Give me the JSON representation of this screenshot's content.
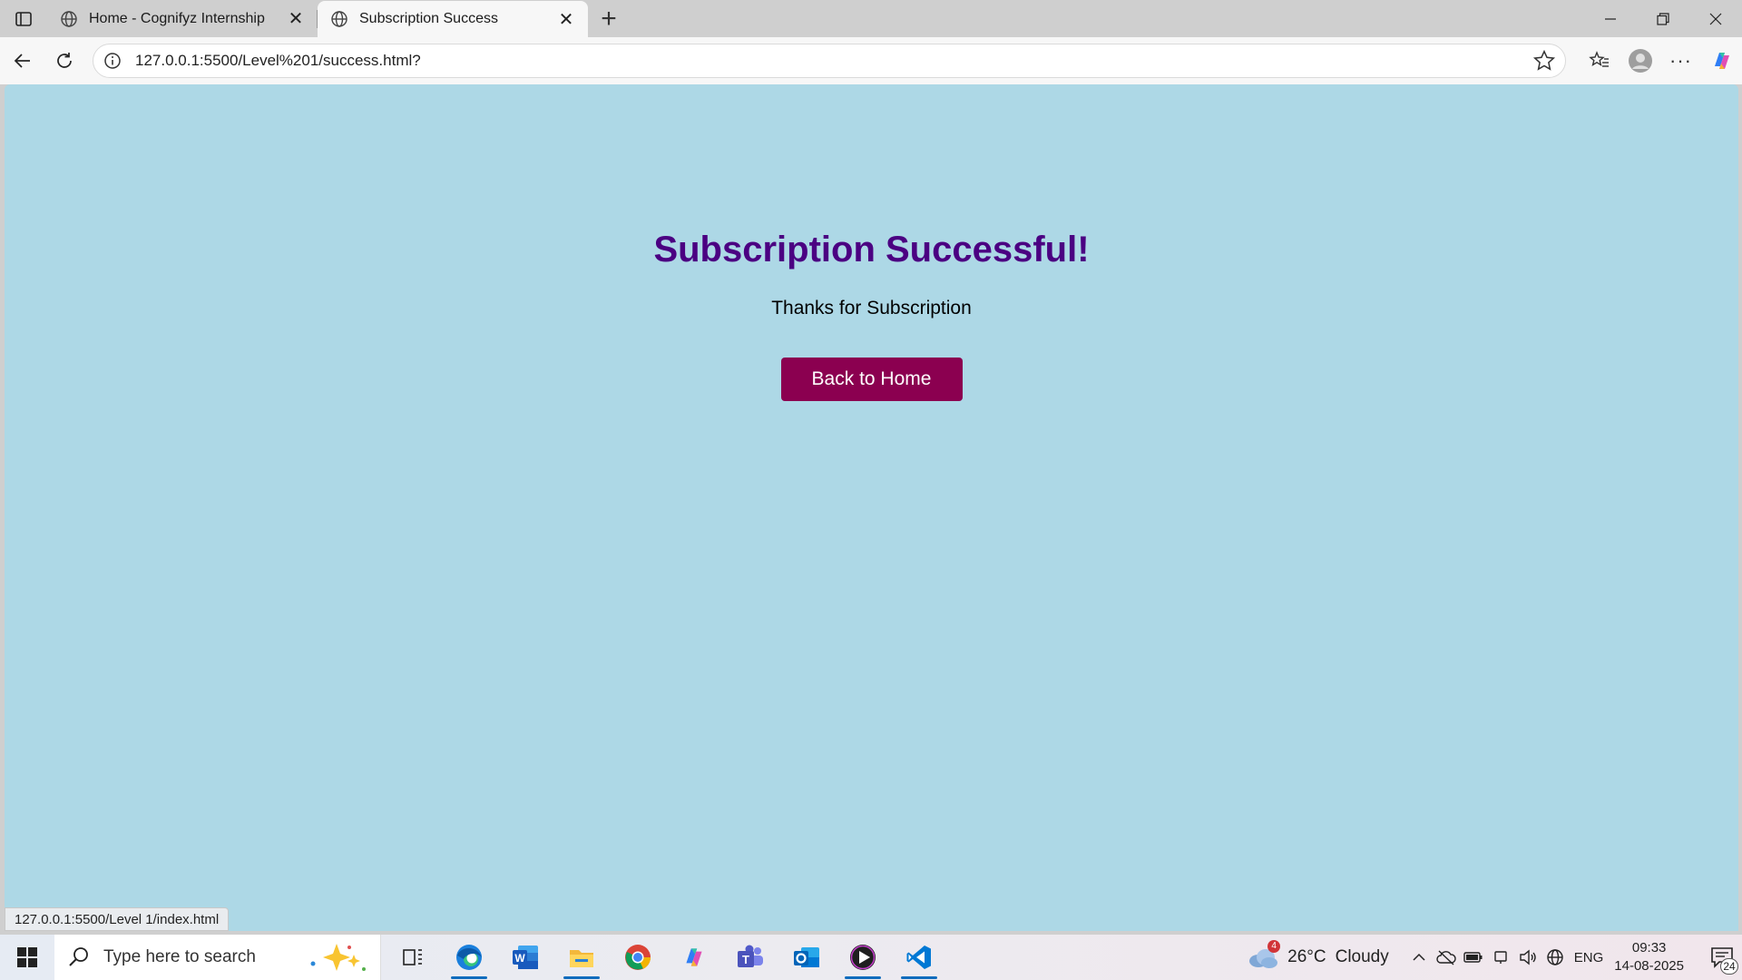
{
  "browser": {
    "tabs": [
      {
        "title": "Home - Cognifyz Internship",
        "active": false
      },
      {
        "title": "Subscription Success",
        "active": true
      }
    ],
    "new_tab_icon": "plus-icon",
    "address": "127.0.0.1:5500/Level%201/success.html?",
    "status_url": "127.0.0.1:5500/Level 1/index.html"
  },
  "page": {
    "background": "#add8e6",
    "heading": "Subscription Successful!",
    "heading_color": "#4b0082",
    "message": "Thanks for Subscription",
    "button_label": "Back to Home",
    "button_color": "#8b0050"
  },
  "taskbar": {
    "search_placeholder": "Type here to search",
    "weather": {
      "temperature": "26°C",
      "condition": "Cloudy",
      "alert_count": "4"
    },
    "language": "ENG",
    "time": "09:33",
    "date": "14-08-2025",
    "notification_count": "24",
    "apps": [
      "edge",
      "word",
      "file-explorer",
      "chrome",
      "copilot",
      "teams",
      "outlook",
      "media-player",
      "vscode"
    ]
  }
}
